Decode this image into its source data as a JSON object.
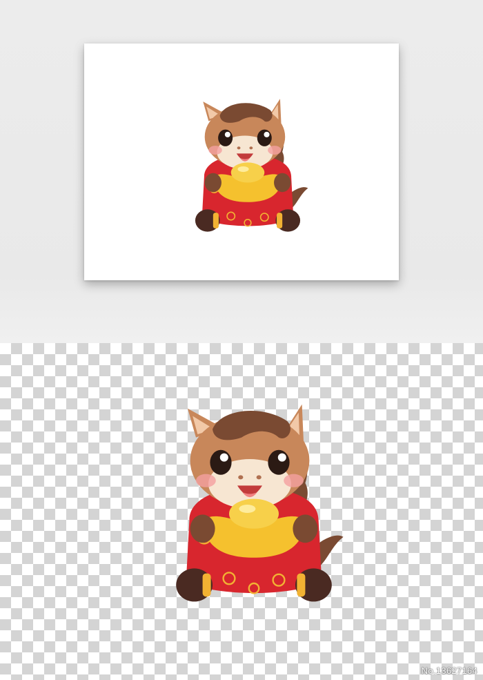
{
  "preview": {
    "subject": "horse-mascot-holding-gold-ingot",
    "background_colors": {
      "band": "#ececec",
      "card": "#ffffff",
      "checker_dark": "#d4d4d4",
      "checker_light": "#ffffff"
    }
  },
  "mascot_colors": {
    "fur": "#c8875a",
    "mane": "#7a4a32",
    "muzzle": "#f7e6d2",
    "robe": "#d8262e",
    "trim": "#f2b233",
    "ingot": "#f5c12e",
    "hoof": "#4a2a22"
  },
  "footer": {
    "id_text": "No.13627164"
  }
}
